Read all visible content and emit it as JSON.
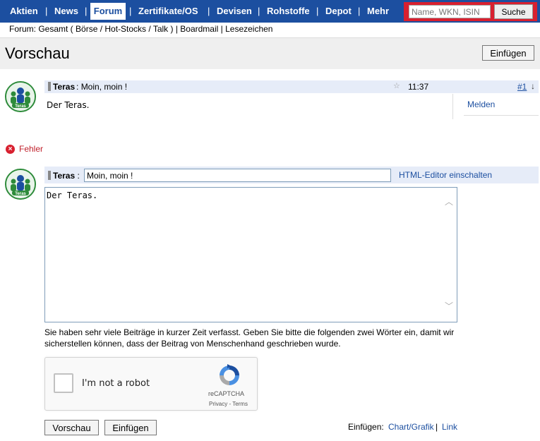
{
  "nav": {
    "items": [
      "Aktien",
      "News",
      "Forum",
      "Zertifikate/OS",
      "Devisen",
      "Rohstoffe",
      "Depot",
      "Mehr"
    ],
    "active": "Forum",
    "search_placeholder": "Name, WKN, ISIN",
    "search_button": "Suche"
  },
  "breadcrumb": "Forum: Gesamt ( Börse / Hot-Stocks / Talk ) | Boardmail | Lesezeichen",
  "header": {
    "title": "Vorschau",
    "insert_button": "Einfügen"
  },
  "avatar": {
    "label": "Teras",
    "top_text": "ariva.de"
  },
  "preview": {
    "author": "Teras",
    "separator": ":",
    "subject": "Moin, moin !",
    "time": "11:37",
    "post_number": "#1",
    "body": "Der Teras.",
    "report_link": "Melden"
  },
  "error": {
    "icon": "error-icon",
    "text": "Fehler"
  },
  "editor": {
    "author": "Teras",
    "separator": ":",
    "subject_value": "Moin, moin !",
    "html_editor_link": "HTML-Editor einschalten",
    "body_value": "Der Teras."
  },
  "notice": "Sie haben sehr viele Beiträge in kurzer Zeit verfasst. Geben Sie bitte die folgenden zwei Wörter ein, damit wir sicherstellen können, dass der Beitrag von Menschenhand geschrieben wurde.",
  "captcha": {
    "label": "I'm not a robot",
    "brand": "reCAPTCHA",
    "terms": "Privacy - Terms"
  },
  "actions": {
    "preview_button": "Vorschau",
    "insert_button": "Einfügen",
    "insert_label": "Einfügen:",
    "chart_link": "Chart/Grafik",
    "separator": "|",
    "link_link": "Link"
  },
  "colors": {
    "nav_bg": "#1c4fa0",
    "link": "#1c4fa0",
    "error": "#c0202b",
    "search_border": "#d8202f"
  }
}
